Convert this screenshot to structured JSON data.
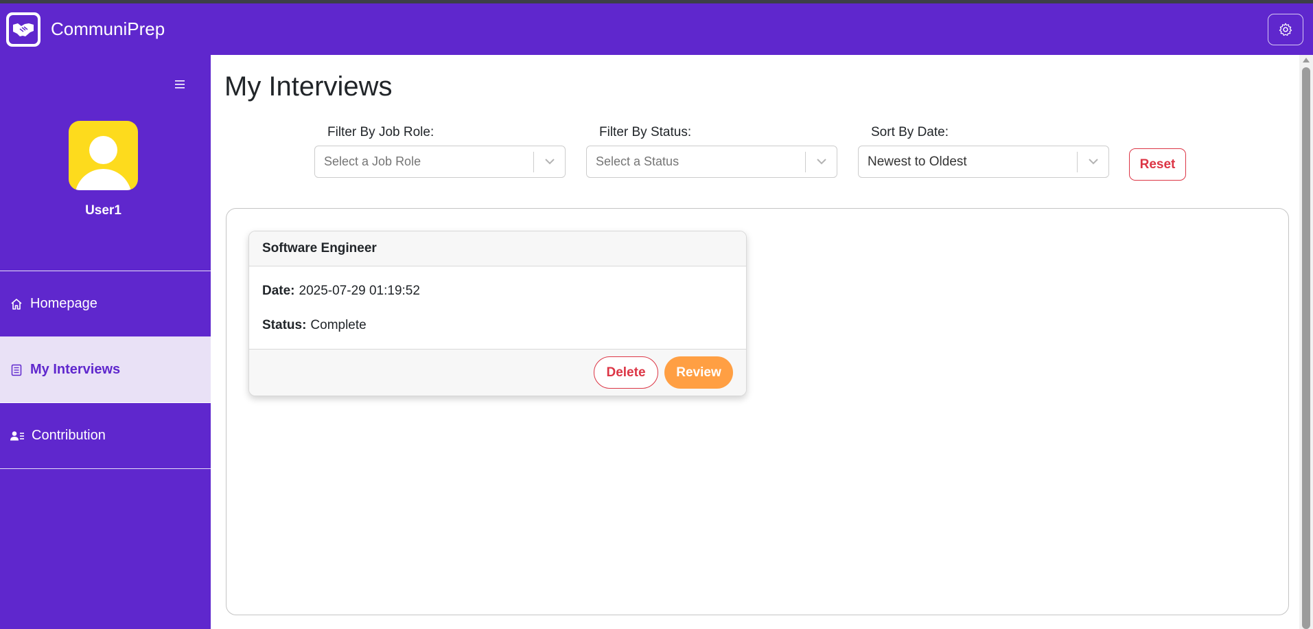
{
  "app": {
    "brand": "CommuniPrep"
  },
  "sidebar": {
    "username": "User1",
    "items": [
      {
        "label": "Homepage",
        "icon": "home-icon",
        "active": false
      },
      {
        "label": "My Interviews",
        "icon": "document-list-icon",
        "active": true
      },
      {
        "label": "Contribution",
        "icon": "user-list-icon",
        "active": false
      }
    ]
  },
  "main": {
    "title": "My Interviews",
    "filters": {
      "job_role": {
        "label": "Filter By Job Role:",
        "placeholder": "Select a Job Role"
      },
      "status": {
        "label": "Filter By Status:",
        "placeholder": "Select a Status"
      },
      "sort": {
        "label": "Sort By Date:",
        "value": "Newest to Oldest"
      },
      "reset_label": "Reset"
    },
    "interviews": [
      {
        "title": "Software Engineer",
        "date_label": "Date:",
        "date": "2025-07-29 01:19:52",
        "status_label": "Status:",
        "status": "Complete",
        "delete_label": "Delete",
        "review_label": "Review"
      }
    ]
  },
  "colors": {
    "brand_purple": "#5f27cd",
    "active_item_bg": "#e9e1f6",
    "avatar_yellow": "#fddb1d",
    "danger": "#dc3545",
    "review_orange": "#ff9f43"
  }
}
